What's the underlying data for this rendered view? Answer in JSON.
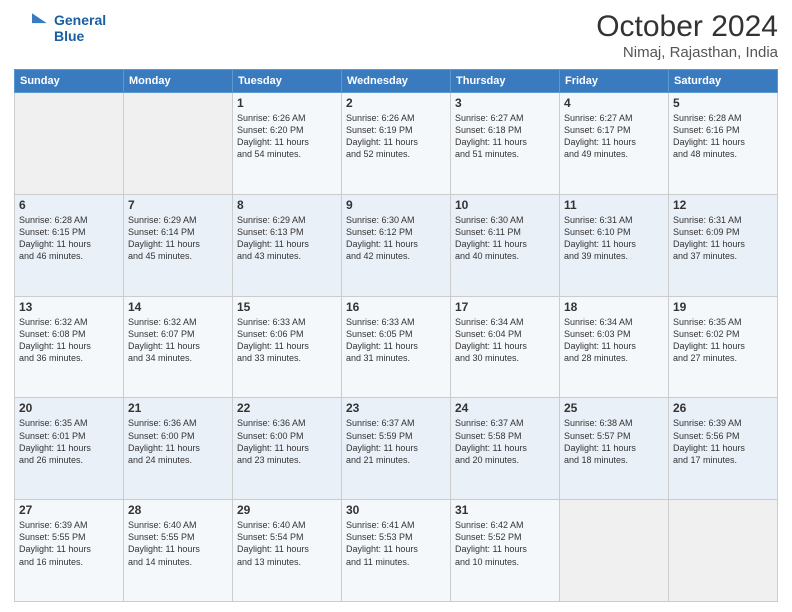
{
  "header": {
    "logo_line1": "General",
    "logo_line2": "Blue",
    "month": "October 2024",
    "location": "Nimaj, Rajasthan, India"
  },
  "weekdays": [
    "Sunday",
    "Monday",
    "Tuesday",
    "Wednesday",
    "Thursday",
    "Friday",
    "Saturday"
  ],
  "weeks": [
    [
      {
        "day": "",
        "info": ""
      },
      {
        "day": "",
        "info": ""
      },
      {
        "day": "1",
        "info": "Sunrise: 6:26 AM\nSunset: 6:20 PM\nDaylight: 11 hours\nand 54 minutes."
      },
      {
        "day": "2",
        "info": "Sunrise: 6:26 AM\nSunset: 6:19 PM\nDaylight: 11 hours\nand 52 minutes."
      },
      {
        "day": "3",
        "info": "Sunrise: 6:27 AM\nSunset: 6:18 PM\nDaylight: 11 hours\nand 51 minutes."
      },
      {
        "day": "4",
        "info": "Sunrise: 6:27 AM\nSunset: 6:17 PM\nDaylight: 11 hours\nand 49 minutes."
      },
      {
        "day": "5",
        "info": "Sunrise: 6:28 AM\nSunset: 6:16 PM\nDaylight: 11 hours\nand 48 minutes."
      }
    ],
    [
      {
        "day": "6",
        "info": "Sunrise: 6:28 AM\nSunset: 6:15 PM\nDaylight: 11 hours\nand 46 minutes."
      },
      {
        "day": "7",
        "info": "Sunrise: 6:29 AM\nSunset: 6:14 PM\nDaylight: 11 hours\nand 45 minutes."
      },
      {
        "day": "8",
        "info": "Sunrise: 6:29 AM\nSunset: 6:13 PM\nDaylight: 11 hours\nand 43 minutes."
      },
      {
        "day": "9",
        "info": "Sunrise: 6:30 AM\nSunset: 6:12 PM\nDaylight: 11 hours\nand 42 minutes."
      },
      {
        "day": "10",
        "info": "Sunrise: 6:30 AM\nSunset: 6:11 PM\nDaylight: 11 hours\nand 40 minutes."
      },
      {
        "day": "11",
        "info": "Sunrise: 6:31 AM\nSunset: 6:10 PM\nDaylight: 11 hours\nand 39 minutes."
      },
      {
        "day": "12",
        "info": "Sunrise: 6:31 AM\nSunset: 6:09 PM\nDaylight: 11 hours\nand 37 minutes."
      }
    ],
    [
      {
        "day": "13",
        "info": "Sunrise: 6:32 AM\nSunset: 6:08 PM\nDaylight: 11 hours\nand 36 minutes."
      },
      {
        "day": "14",
        "info": "Sunrise: 6:32 AM\nSunset: 6:07 PM\nDaylight: 11 hours\nand 34 minutes."
      },
      {
        "day": "15",
        "info": "Sunrise: 6:33 AM\nSunset: 6:06 PM\nDaylight: 11 hours\nand 33 minutes."
      },
      {
        "day": "16",
        "info": "Sunrise: 6:33 AM\nSunset: 6:05 PM\nDaylight: 11 hours\nand 31 minutes."
      },
      {
        "day": "17",
        "info": "Sunrise: 6:34 AM\nSunset: 6:04 PM\nDaylight: 11 hours\nand 30 minutes."
      },
      {
        "day": "18",
        "info": "Sunrise: 6:34 AM\nSunset: 6:03 PM\nDaylight: 11 hours\nand 28 minutes."
      },
      {
        "day": "19",
        "info": "Sunrise: 6:35 AM\nSunset: 6:02 PM\nDaylight: 11 hours\nand 27 minutes."
      }
    ],
    [
      {
        "day": "20",
        "info": "Sunrise: 6:35 AM\nSunset: 6:01 PM\nDaylight: 11 hours\nand 26 minutes."
      },
      {
        "day": "21",
        "info": "Sunrise: 6:36 AM\nSunset: 6:00 PM\nDaylight: 11 hours\nand 24 minutes."
      },
      {
        "day": "22",
        "info": "Sunrise: 6:36 AM\nSunset: 6:00 PM\nDaylight: 11 hours\nand 23 minutes."
      },
      {
        "day": "23",
        "info": "Sunrise: 6:37 AM\nSunset: 5:59 PM\nDaylight: 11 hours\nand 21 minutes."
      },
      {
        "day": "24",
        "info": "Sunrise: 6:37 AM\nSunset: 5:58 PM\nDaylight: 11 hours\nand 20 minutes."
      },
      {
        "day": "25",
        "info": "Sunrise: 6:38 AM\nSunset: 5:57 PM\nDaylight: 11 hours\nand 18 minutes."
      },
      {
        "day": "26",
        "info": "Sunrise: 6:39 AM\nSunset: 5:56 PM\nDaylight: 11 hours\nand 17 minutes."
      }
    ],
    [
      {
        "day": "27",
        "info": "Sunrise: 6:39 AM\nSunset: 5:55 PM\nDaylight: 11 hours\nand 16 minutes."
      },
      {
        "day": "28",
        "info": "Sunrise: 6:40 AM\nSunset: 5:55 PM\nDaylight: 11 hours\nand 14 minutes."
      },
      {
        "day": "29",
        "info": "Sunrise: 6:40 AM\nSunset: 5:54 PM\nDaylight: 11 hours\nand 13 minutes."
      },
      {
        "day": "30",
        "info": "Sunrise: 6:41 AM\nSunset: 5:53 PM\nDaylight: 11 hours\nand 11 minutes."
      },
      {
        "day": "31",
        "info": "Sunrise: 6:42 AM\nSunset: 5:52 PM\nDaylight: 11 hours\nand 10 minutes."
      },
      {
        "day": "",
        "info": ""
      },
      {
        "day": "",
        "info": ""
      }
    ]
  ]
}
